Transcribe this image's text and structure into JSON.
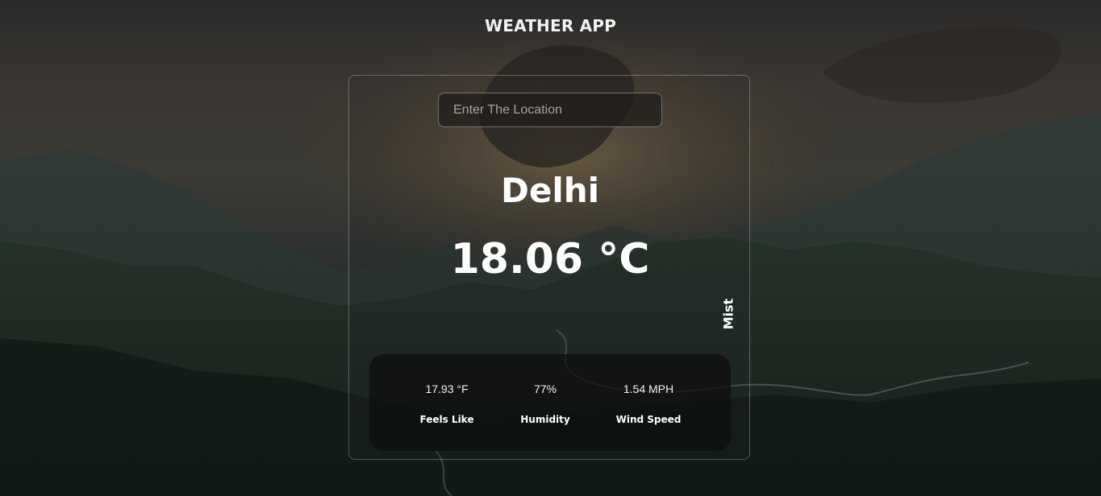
{
  "app": {
    "title": "WEATHER APP"
  },
  "search": {
    "placeholder": "Enter The Location",
    "value": ""
  },
  "weather": {
    "city": "Delhi",
    "temperature": "18.06 °C",
    "condition": "Mist"
  },
  "stats": [
    {
      "value": "17.93 °F",
      "label": "Feels Like"
    },
    {
      "value": "77%",
      "label": "Humidity"
    },
    {
      "value": "1.54 MPH",
      "label": "Wind Speed"
    }
  ],
  "colors": {
    "text": "#ffffff",
    "panel": "#0c0e0e",
    "sky": "#3a3631",
    "mountains": "#1f2a26"
  }
}
